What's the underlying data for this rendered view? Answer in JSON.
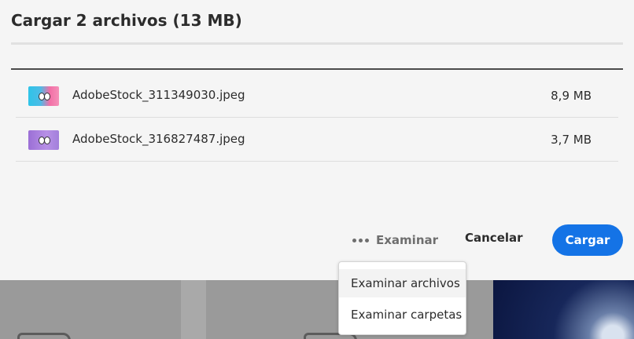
{
  "dialog": {
    "title": "Cargar 2 archivos (13 MB)",
    "files": [
      {
        "name": "AdobeStock_311349030.jpeg",
        "size": "8,9 MB"
      },
      {
        "name": "AdobeStock_316827487.jpeg",
        "size": "3,7 MB"
      }
    ],
    "examinar_label": "Examinar",
    "cancel_label": "Cancelar",
    "upload_label": "Cargar"
  },
  "menu": {
    "items": [
      {
        "label": "Examinar archivos"
      },
      {
        "label": "Examinar carpetas"
      }
    ]
  },
  "colors": {
    "accent": "#1473e6",
    "background": "#f5f5f5",
    "muted_text": "#6e6e6e"
  }
}
